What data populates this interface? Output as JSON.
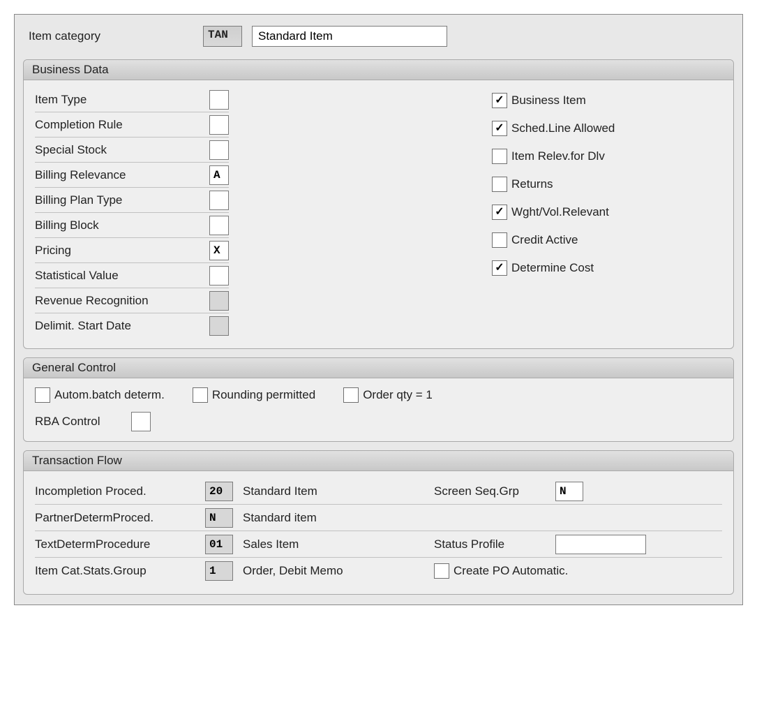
{
  "header": {
    "label": "Item category",
    "code": "TAN",
    "description": "Standard Item"
  },
  "sections": {
    "business_data": {
      "title": "Business Data",
      "fields": [
        {
          "label": "Item Type",
          "value": "",
          "readonly": false
        },
        {
          "label": "Completion Rule",
          "value": "",
          "readonly": false
        },
        {
          "label": "Special Stock",
          "value": "",
          "readonly": false
        },
        {
          "label": "Billing Relevance",
          "value": "A",
          "readonly": false
        },
        {
          "label": "Billing Plan Type",
          "value": "",
          "readonly": false
        },
        {
          "label": "Billing Block",
          "value": "",
          "readonly": false
        },
        {
          "label": "Pricing",
          "value": "X",
          "readonly": false
        },
        {
          "label": "Statistical Value",
          "value": "",
          "readonly": false
        },
        {
          "label": "Revenue Recognition",
          "value": "",
          "readonly": true
        },
        {
          "label": "Delimit. Start Date",
          "value": "",
          "readonly": true
        }
      ],
      "checks": [
        {
          "label": "Business Item",
          "checked": true
        },
        {
          "label": "Sched.Line Allowed",
          "checked": true
        },
        {
          "label": "Item Relev.for Dlv",
          "checked": false
        },
        {
          "label": "Returns",
          "checked": false
        },
        {
          "label": "Wght/Vol.Relevant",
          "checked": true
        },
        {
          "label": "Credit Active",
          "checked": false
        },
        {
          "label": "Determine Cost",
          "checked": true
        }
      ]
    },
    "general_control": {
      "title": "General Control",
      "checks": [
        {
          "label": "Autom.batch determ.",
          "checked": false
        },
        {
          "label": "Rounding permitted",
          "checked": false
        },
        {
          "label": "Order qty = 1",
          "checked": false
        }
      ],
      "rba_label": "RBA Control",
      "rba_value": ""
    },
    "transaction_flow": {
      "title": "Transaction Flow",
      "rows": [
        {
          "label": "Incompletion Proced.",
          "code": "20",
          "desc": "Standard Item",
          "right_label": "Screen Seq.Grp",
          "right_value": "N",
          "right_type": "input_small"
        },
        {
          "label": "PartnerDetermProced.",
          "code": "N",
          "desc": "Standard item",
          "right_label": "",
          "right_value": "",
          "right_type": "none"
        },
        {
          "label": "TextDetermProcedure",
          "code": "01",
          "desc": "Sales Item",
          "right_label": "Status Profile",
          "right_value": "",
          "right_type": "input_wide"
        },
        {
          "label": "Item Cat.Stats.Group",
          "code": "1",
          "desc": "Order, Debit Memo",
          "right_label": "Create PO Automatic.",
          "right_value": false,
          "right_type": "checkbox"
        }
      ]
    }
  }
}
